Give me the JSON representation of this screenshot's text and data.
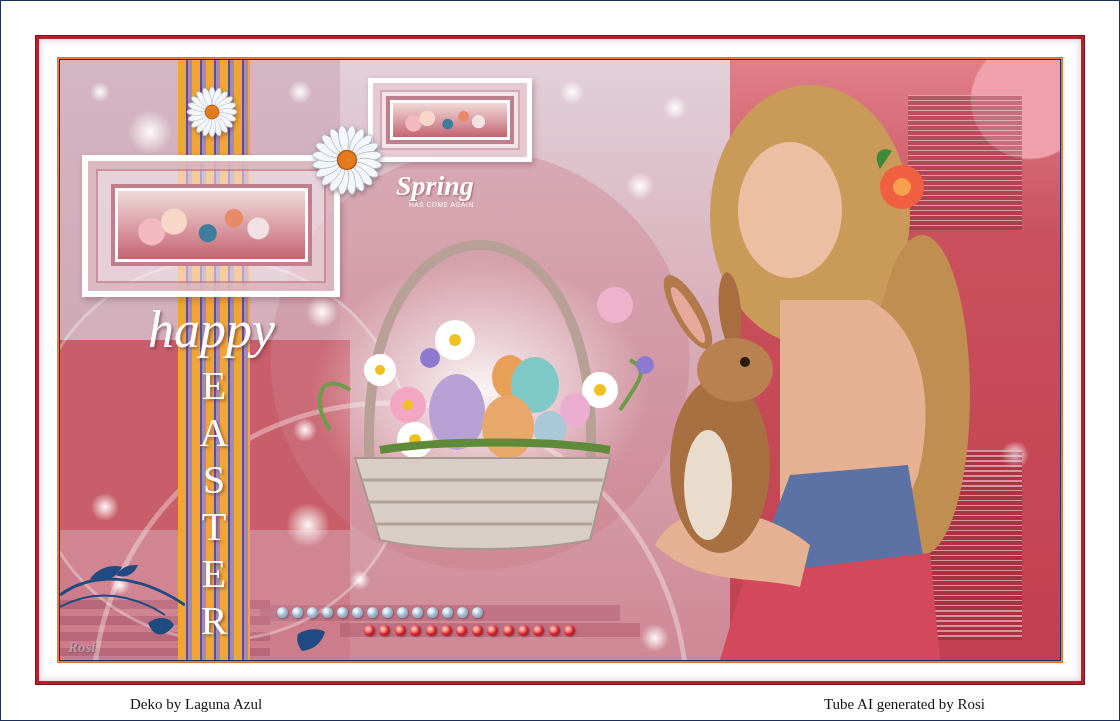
{
  "artwork": {
    "spring_text": {
      "title": "Spring",
      "subtitle": "HAS COME AGAIN"
    },
    "greeting": {
      "script": "happy",
      "main": "EASTER"
    },
    "signature": "Rosi"
  },
  "credits": [
    "Deko by Laguna Azul",
    "Tube AI generated by Rosi"
  ]
}
